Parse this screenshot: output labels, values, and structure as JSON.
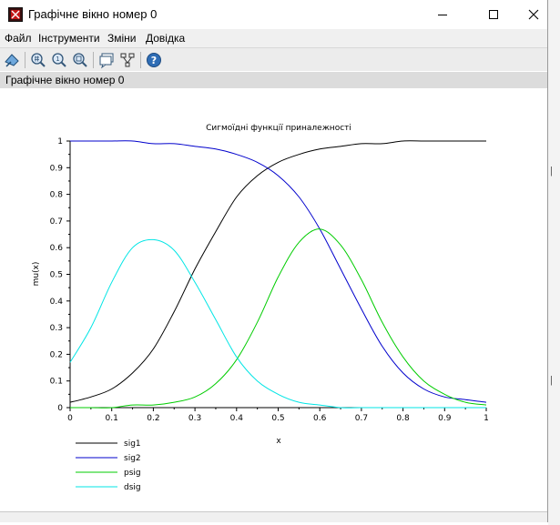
{
  "window": {
    "title": "Графічне вікно номер 0"
  },
  "window_controls": {
    "minimize": "—",
    "maximize": "☐",
    "close": "✕"
  },
  "menu": [
    {
      "label": "Файл"
    },
    {
      "label": "Інструменти"
    },
    {
      "label": "Зміни"
    },
    {
      "label": "Довідка"
    }
  ],
  "toolbar": {
    "icons": [
      "rotate-icon",
      "zoom-in-icon",
      "zoom-original-icon",
      "zoom-area-icon",
      "datatip-icon",
      "tree-icon",
      "help-icon"
    ]
  },
  "infobar": {
    "text": "Графічне вікно номер 0"
  },
  "chart_data": {
    "type": "line",
    "title": "Сигмоїдні функції приналежності",
    "xlabel": "x",
    "ylabel": "mu(x)",
    "xlim": [
      0,
      1
    ],
    "ylim": [
      0,
      1
    ],
    "xticks": [
      "0",
      "0.1",
      "0.2",
      "0.3",
      "0.4",
      "0.5",
      "0.6",
      "0.7",
      "0.8",
      "0.9",
      "1"
    ],
    "yticks": [
      "0",
      "0.1",
      "0.2",
      "0.3",
      "0.4",
      "0.5",
      "0.6",
      "0.7",
      "0.8",
      "0.9",
      "1"
    ],
    "grid": false,
    "legend_position": "bottom-left",
    "x": [
      0,
      0.05,
      0.1,
      0.15,
      0.2,
      0.25,
      0.3,
      0.35,
      0.4,
      0.45,
      0.5,
      0.55,
      0.6,
      0.65,
      0.7,
      0.75,
      0.8,
      0.85,
      0.9,
      0.95,
      1.0
    ],
    "series": [
      {
        "name": "sig1",
        "color": "#000000",
        "values": [
          0.02,
          0.04,
          0.07,
          0.13,
          0.22,
          0.36,
          0.52,
          0.66,
          0.79,
          0.87,
          0.92,
          0.95,
          0.97,
          0.98,
          0.99,
          0.99,
          1.0,
          1.0,
          1.0,
          1.0,
          1.0
        ]
      },
      {
        "name": "sig2",
        "color": "#0000cc",
        "values": [
          1.0,
          1.0,
          1.0,
          1.0,
          0.99,
          0.99,
          0.98,
          0.97,
          0.95,
          0.92,
          0.87,
          0.79,
          0.67,
          0.52,
          0.37,
          0.23,
          0.13,
          0.07,
          0.04,
          0.03,
          0.02
        ]
      },
      {
        "name": "psig",
        "color": "#00cc00",
        "values": [
          0.0,
          0.0,
          0.0,
          0.01,
          0.01,
          0.02,
          0.04,
          0.09,
          0.18,
          0.32,
          0.49,
          0.62,
          0.67,
          0.61,
          0.48,
          0.32,
          0.19,
          0.1,
          0.05,
          0.02,
          0.01
        ]
      },
      {
        "name": "dsig",
        "color": "#00e5e5",
        "values": [
          0.17,
          0.3,
          0.47,
          0.6,
          0.63,
          0.59,
          0.47,
          0.33,
          0.19,
          0.1,
          0.05,
          0.02,
          0.01,
          0.0,
          0.0,
          0.0,
          0.0,
          0.0,
          0.0,
          0.0,
          0.0
        ]
      }
    ]
  }
}
